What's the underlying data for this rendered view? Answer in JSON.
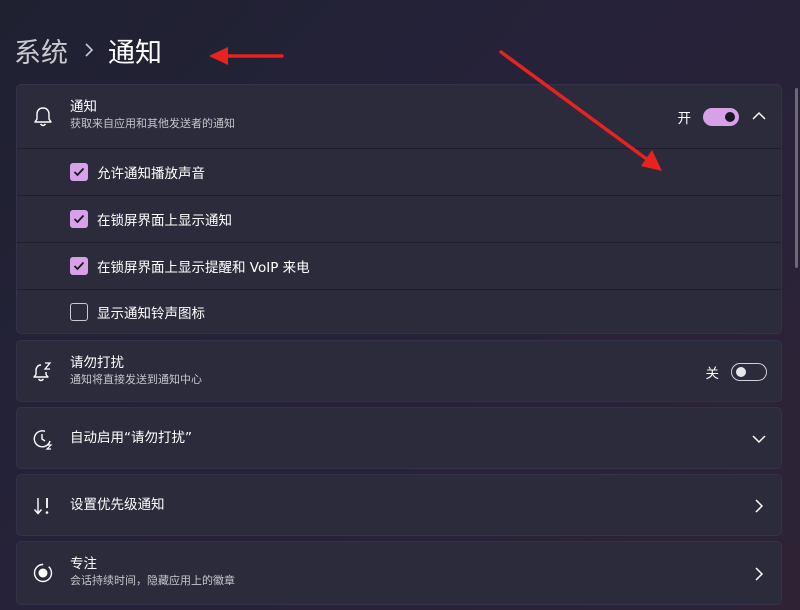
{
  "breadcrumb": {
    "parent": "系统",
    "current": "通知"
  },
  "notifications": {
    "title": "通知",
    "subtitle": "获取来自应用和其他发送者的通知",
    "toggle_label": "开",
    "toggle_state": "on",
    "icon": "bell-icon",
    "options": [
      {
        "label": "允许通知播放声音",
        "checked": true
      },
      {
        "label": "在锁屏界面上显示通知",
        "checked": true
      },
      {
        "label": "在锁屏界面上显示提醒和 VoIP 来电",
        "checked": true
      },
      {
        "label": "显示通知铃声图标",
        "checked": false
      }
    ]
  },
  "dnd": {
    "title": "请勿打扰",
    "subtitle": "通知将直接发送到通知中心",
    "toggle_label": "关",
    "toggle_state": "off",
    "icon": "bell-snooze-icon"
  },
  "auto_dnd": {
    "title": "自动启用“请勿打扰”",
    "icon": "clock-icon"
  },
  "priority": {
    "title": "设置优先级通知",
    "icon": "priority-sort-icon"
  },
  "focus": {
    "title": "专注",
    "subtitle": "会话持续时间，隐藏应用上的徽章",
    "icon": "focus-icon"
  },
  "colors": {
    "accent": "#d7a1e8",
    "card_bg": "#2c2b3b",
    "annotation_arrow": "#e8231f"
  }
}
